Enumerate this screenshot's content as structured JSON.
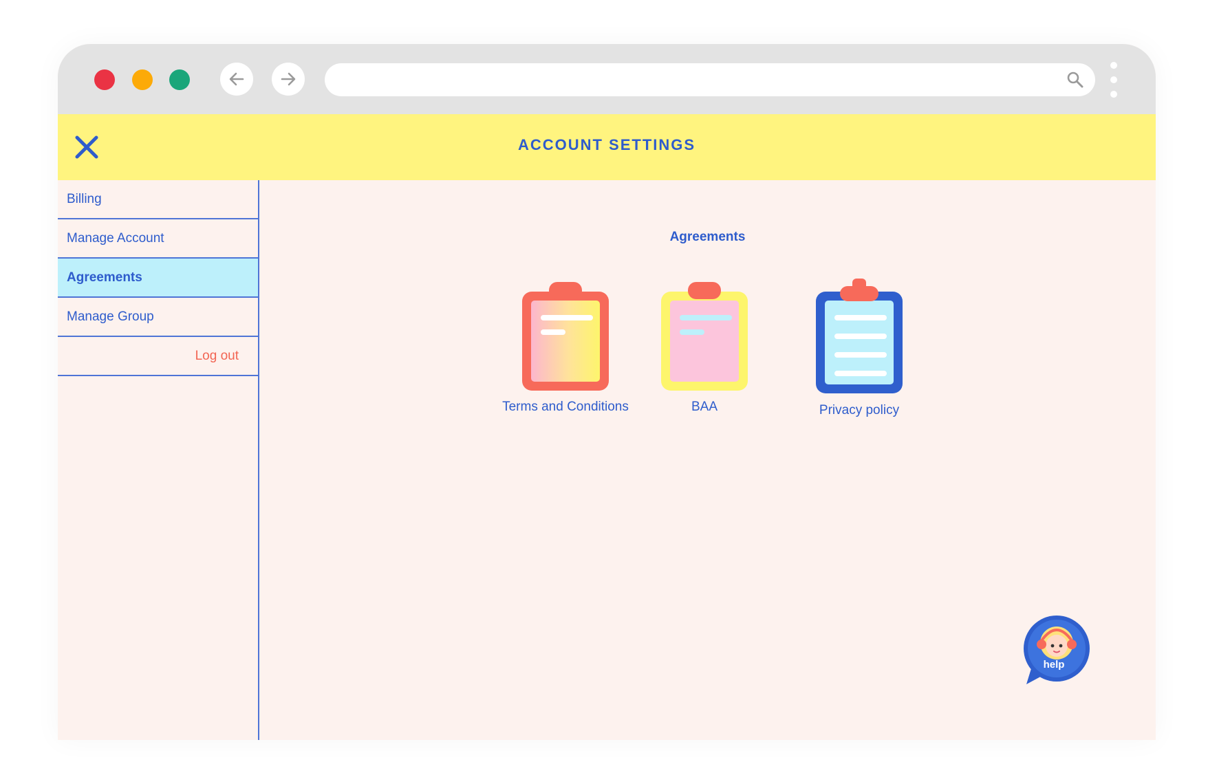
{
  "browser": {
    "address_placeholder": "",
    "icons": {
      "back": "arrow-left-icon",
      "forward": "arrow-right-icon",
      "search": "search-icon",
      "menu": "kebab-menu-icon"
    }
  },
  "header": {
    "title": "ACCOUNT SETTINGS",
    "close_icon": "close-icon"
  },
  "sidebar": {
    "items": [
      {
        "label": "Billing"
      },
      {
        "label": "Manage Account"
      },
      {
        "label": "Agreements",
        "active": true
      },
      {
        "label": "Manage Group"
      }
    ],
    "logout_label": "Log out"
  },
  "content": {
    "title": "Agreements",
    "documents": [
      {
        "label": "Terms and Conditions",
        "icon": "clipboard-icon"
      },
      {
        "label": "BAA",
        "icon": "clipboard-icon"
      },
      {
        "label": "Privacy policy",
        "icon": "clipboard-icon"
      }
    ]
  },
  "help": {
    "label": "help",
    "icon": "support-agent-icon"
  },
  "colors": {
    "accent_blue": "#2e5ccc",
    "header_yellow": "#fff47f",
    "active_item": "#bdf0fb",
    "logout_red": "#f26553",
    "background": "#fdf2ee"
  }
}
